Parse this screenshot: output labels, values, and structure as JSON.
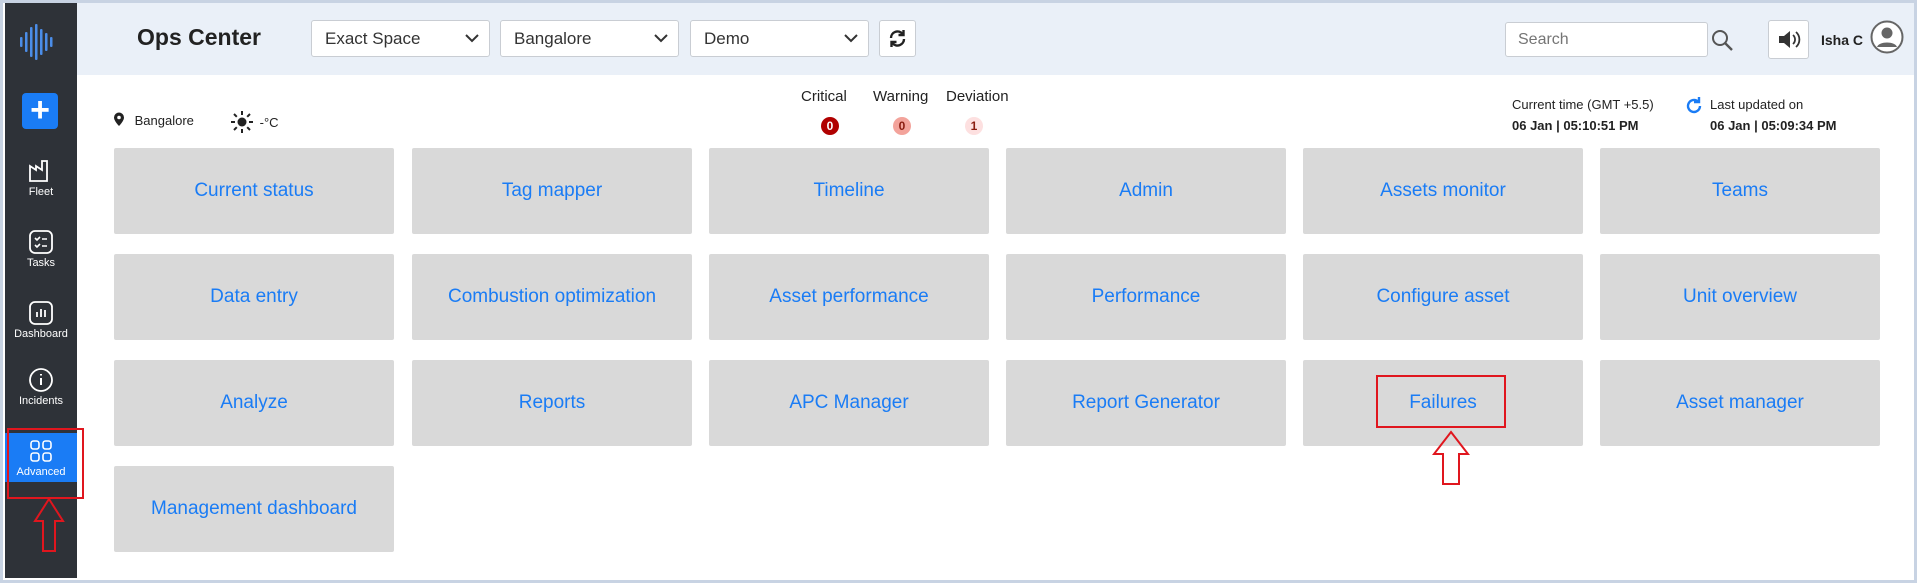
{
  "sidebar": {
    "items": [
      {
        "label": "Fleet",
        "icon": "factory-icon"
      },
      {
        "label": "Tasks",
        "icon": "checklist-icon"
      },
      {
        "label": "Dashboard",
        "icon": "dashboard-icon"
      },
      {
        "label": "Incidents",
        "icon": "info-icon"
      },
      {
        "label": "Advanced",
        "icon": "grid-icon",
        "active": true
      }
    ],
    "add_label": "+"
  },
  "header": {
    "title": "Ops Center",
    "space_select": "Exact Space",
    "location_select": "Bangalore",
    "mode_select": "Demo",
    "search_placeholder": "Search",
    "user_name": "Isha C"
  },
  "info": {
    "location": "Bangalore",
    "temperature": "-°C",
    "status": {
      "critical_label": "Critical",
      "critical_count": "0",
      "warning_label": "Warning",
      "warning_count": "0",
      "deviation_label": "Deviation",
      "deviation_count": "1"
    },
    "current_time_label": "Current time (GMT +5.5)",
    "current_time_value": "06 Jan | 05:10:51 PM",
    "last_updated_label": "Last updated on",
    "last_updated_value": "06 Jan | 05:09:34 PM"
  },
  "tiles": [
    "Current status",
    "Tag mapper",
    "Timeline",
    "Admin",
    "Assets monitor",
    "Teams",
    "Data entry",
    "Combustion optimization",
    "Asset performance",
    "Performance",
    "Configure asset",
    "Unit overview",
    "Analyze",
    "Reports",
    "APC Manager",
    "Report Generator",
    "Failures",
    "Asset manager",
    "Management dashboard"
  ],
  "colors": {
    "accent": "#1a7cf5",
    "sidebar": "#2e3238",
    "critical": "#b00000",
    "warning": "#f3a39b",
    "deviation": "#fde0e0",
    "annotation": "#e0161e"
  }
}
